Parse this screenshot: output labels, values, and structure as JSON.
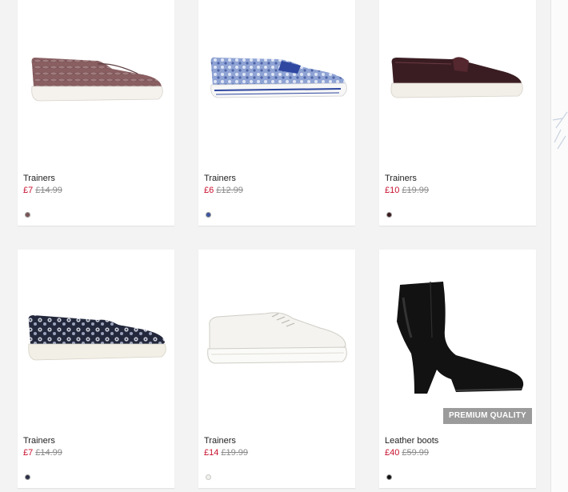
{
  "products": [
    {
      "name": "Trainers",
      "price": "£7",
      "was_price": "£14.99",
      "swatch_color": "#7a5456",
      "image": "pink-snakeskin-slip-on-icon"
    },
    {
      "name": "Trainers",
      "price": "£6",
      "was_price": "£12.99",
      "swatch_color": "#3c56a0",
      "image": "blue-paisley-slip-on-icon"
    },
    {
      "name": "Trainers",
      "price": "£10",
      "was_price": "£19.99",
      "swatch_color": "#3a1a1e",
      "image": "burgundy-slip-on-icon"
    },
    {
      "name": "Trainers",
      "price": "£7",
      "was_price": "£14.99",
      "swatch_color": "#2a2f45",
      "image": "navy-floral-slip-on-icon"
    },
    {
      "name": "Trainers",
      "price": "£14",
      "was_price": "£19.99",
      "swatch_color": "#f1f1ec",
      "image": "white-lace-up-trainer-icon"
    },
    {
      "name": "Leather boots",
      "price": "£40",
      "was_price": "£59.99",
      "swatch_color": "#111111",
      "image": "black-leather-boot-icon",
      "badge": "PREMIUM QUALITY"
    }
  ],
  "colors": {
    "price": "#c8102e",
    "was_price": "#8a8a8a",
    "badge_bg": "#9b9b9b"
  }
}
